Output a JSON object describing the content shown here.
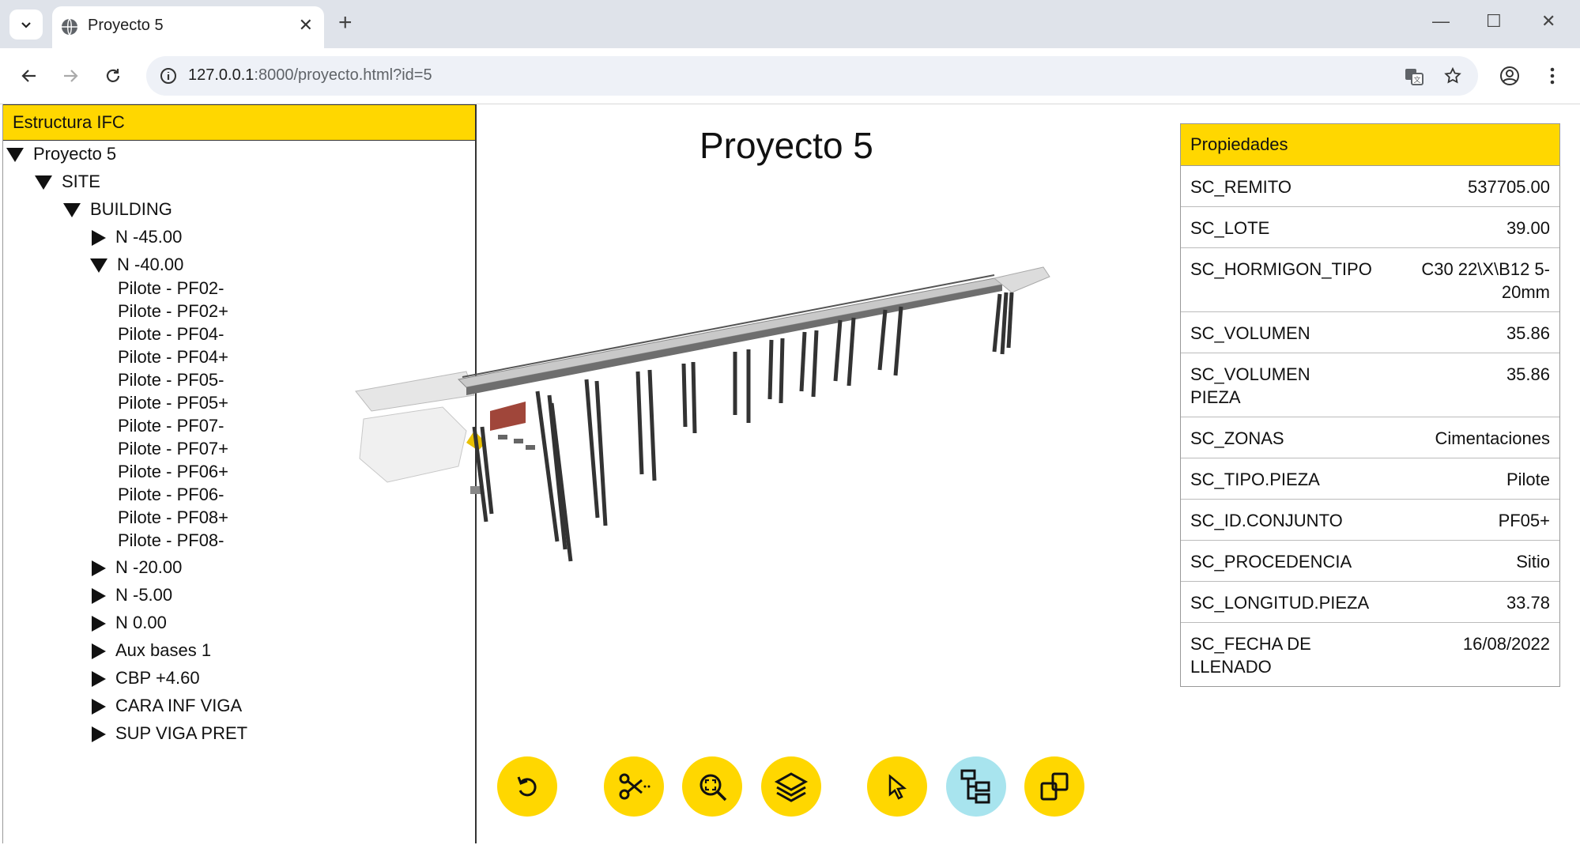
{
  "browser": {
    "tab_title": "Proyecto 5",
    "url_host": "127.0.0.1",
    "url_rest": ":8000/proyecto.html?id=5",
    "new_tab": "+",
    "close": "✕",
    "minimize": "—",
    "maximize": "☐",
    "close_window": "✕"
  },
  "left_panel": {
    "title": "Estructura IFC",
    "tree": {
      "project": "Proyecto 5",
      "site": "SITE",
      "building": "BUILDING",
      "levels": [
        {
          "label": "N -45.00",
          "expanded": false
        },
        {
          "label": "N -40.00",
          "expanded": true
        },
        {
          "label": "N -20.00",
          "expanded": false
        },
        {
          "label": "N -5.00",
          "expanded": false
        },
        {
          "label": "N 0.00",
          "expanded": false
        },
        {
          "label": "Aux bases 1",
          "expanded": false
        },
        {
          "label": "CBP +4.60",
          "expanded": false
        },
        {
          "label": "CARA INF VIGA",
          "expanded": false
        },
        {
          "label": "SUP VIGA PRET",
          "expanded": false
        }
      ],
      "children_n40": [
        "Pilote - PF02-",
        "Pilote - PF02+",
        "Pilote - PF04-",
        "Pilote - PF04+",
        "Pilote - PF05-",
        "Pilote - PF05+",
        "Pilote - PF07-",
        "Pilote - PF07+",
        "Pilote - PF06+",
        "Pilote - PF06-",
        "Pilote - PF08+",
        "Pilote - PF08-"
      ]
    }
  },
  "viewer": {
    "title": "Proyecto 5",
    "buttons": [
      "reset-view",
      "section-cut",
      "zoom-fit",
      "layers",
      "select",
      "tree",
      "compare"
    ],
    "active_button": "tree",
    "accent": "#FFD700",
    "active_color": "#A8E4EE"
  },
  "properties": {
    "title": "Propiedades",
    "rows": [
      {
        "key": "SC_REMITO",
        "value": "537705.00"
      },
      {
        "key": "SC_LOTE",
        "value": "39.00"
      },
      {
        "key": "SC_HORMIGON_TIPO",
        "value": "C30 22\\X\\B12 5-20mm"
      },
      {
        "key": "SC_VOLUMEN",
        "value": "35.86"
      },
      {
        "key": "SC_VOLUMEN PIEZA",
        "value": "35.86"
      },
      {
        "key": "SC_ZONAS",
        "value": "Cimentaciones"
      },
      {
        "key": "SC_TIPO.PIEZA",
        "value": "Pilote"
      },
      {
        "key": "SC_ID.CONJUNTO",
        "value": "PF05+"
      },
      {
        "key": "SC_PROCEDENCIA",
        "value": "Sitio"
      },
      {
        "key": "SC_LONGITUD.PIEZA",
        "value": "33.78"
      },
      {
        "key": "SC_FECHA DE LLENADO",
        "value": "16/08/2022"
      }
    ]
  }
}
